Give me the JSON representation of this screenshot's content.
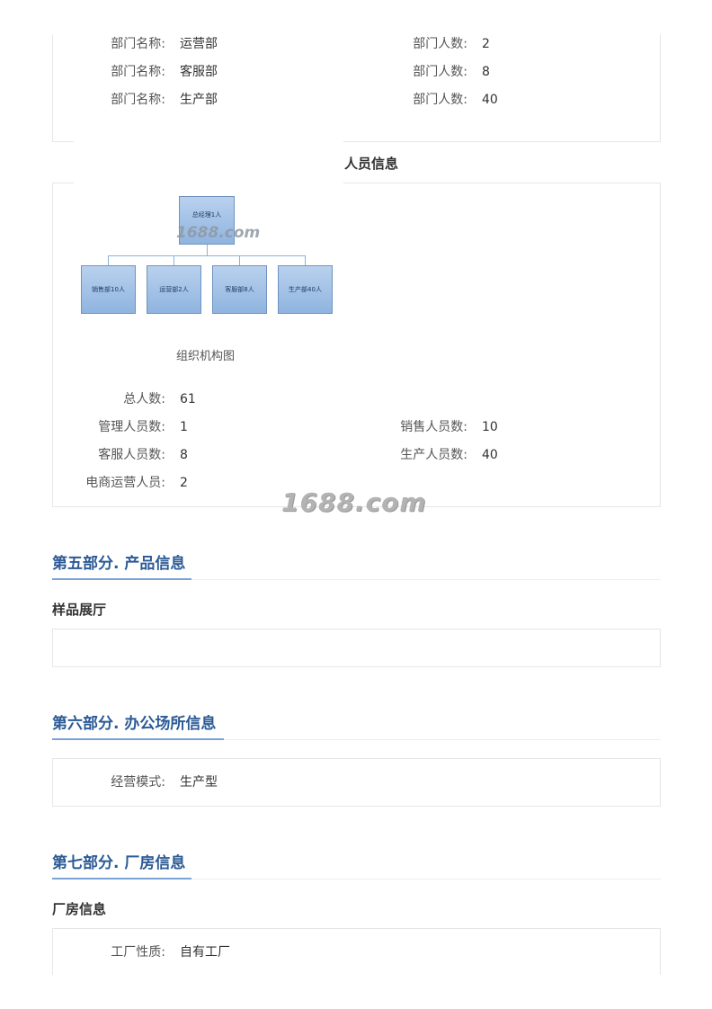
{
  "departments": [
    {
      "name_label": "部门名称:",
      "name": "运营部",
      "count_label": "部门人数:",
      "count": "2"
    },
    {
      "name_label": "部门名称:",
      "name": "客服部",
      "count_label": "部门人数:",
      "count": "8"
    },
    {
      "name_label": "部门名称:",
      "name": "生产部",
      "count_label": "部门人数:",
      "count": "40"
    }
  ],
  "personnel": {
    "title": "人员信息",
    "org_chart": {
      "root": "总经理1人",
      "children": [
        "销售部10人",
        "运营部2人",
        "客服部8人",
        "生产部40人"
      ],
      "caption": "组织机构图"
    },
    "stats": {
      "total_label": "总人数:",
      "total": "61",
      "mgmt_label": "管理人员数:",
      "mgmt": "1",
      "sales_label": "销售人员数:",
      "sales": "10",
      "service_label": "客服人员数:",
      "service": "8",
      "production_label": "生产人员数:",
      "production": "40",
      "ecommerce_label": "电商运营人员:",
      "ecommerce": "2"
    }
  },
  "watermark": {
    "small": "1688.com",
    "big": "1688.com"
  },
  "section5": {
    "title": "第五部分. 产品信息",
    "subtitle": "样品展厅"
  },
  "section6": {
    "title": "第六部分. 办公场所信息",
    "mode_label": "经营模式:",
    "mode": "生产型"
  },
  "section7": {
    "title": "第七部分. 厂房信息",
    "subtitle": "厂房信息",
    "nature_label": "工厂性质:",
    "nature": "自有工厂"
  }
}
